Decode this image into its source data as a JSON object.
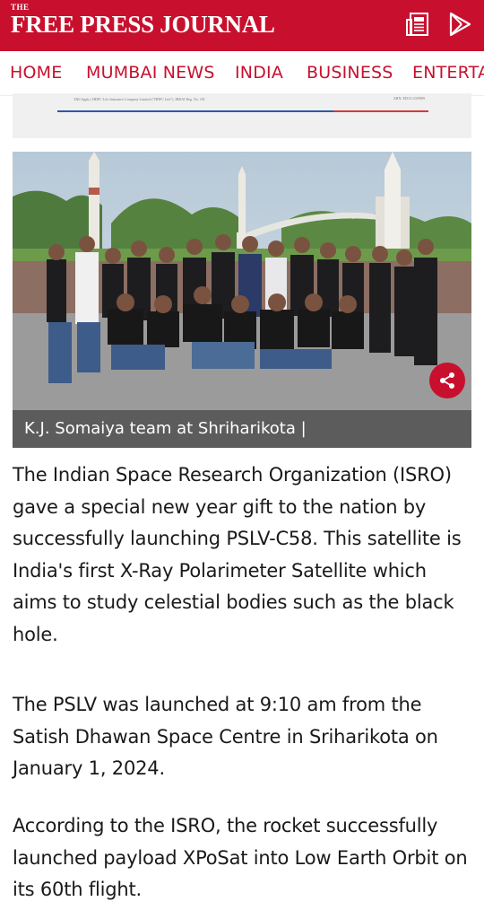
{
  "header": {
    "logo_the": "THE",
    "logo_name": "FREE PRESS JOURNAL",
    "brand_color": "#c8102e",
    "icons": [
      "epaper-icon",
      "play-store-icon"
    ]
  },
  "nav": {
    "items": [
      "HOME",
      "MUMBAI NEWS",
      "INDIA",
      "BUSINESS",
      "ENTERTA"
    ]
  },
  "ad": {
    "text_left": "T&CApply | HDFC Life Insurance Company Limited (\"HDFC Life\"). IRDAI Reg. No. 101",
    "text_right": "ARN: ED/11/23/9909"
  },
  "article": {
    "image_caption": "K.J. Somaiya team at Shriharikota |",
    "paragraphs": [
      "The Indian Space Research Organization (ISRO) gave a special new year gift to the nation by successfully launching PSLV-C58. This satellite is India's first X-Ray Polarimeter Satellite which aims to study celestial bodies such as the black hole.",
      "The PSLV was launched at 9:10 am from the Satish Dhawan Space Centre in Sriharikota on January 1, 2024.",
      "According to the ISRO, the rocket successfully launched payload XPoSat into Low Earth Orbit on its 60th flight."
    ]
  }
}
